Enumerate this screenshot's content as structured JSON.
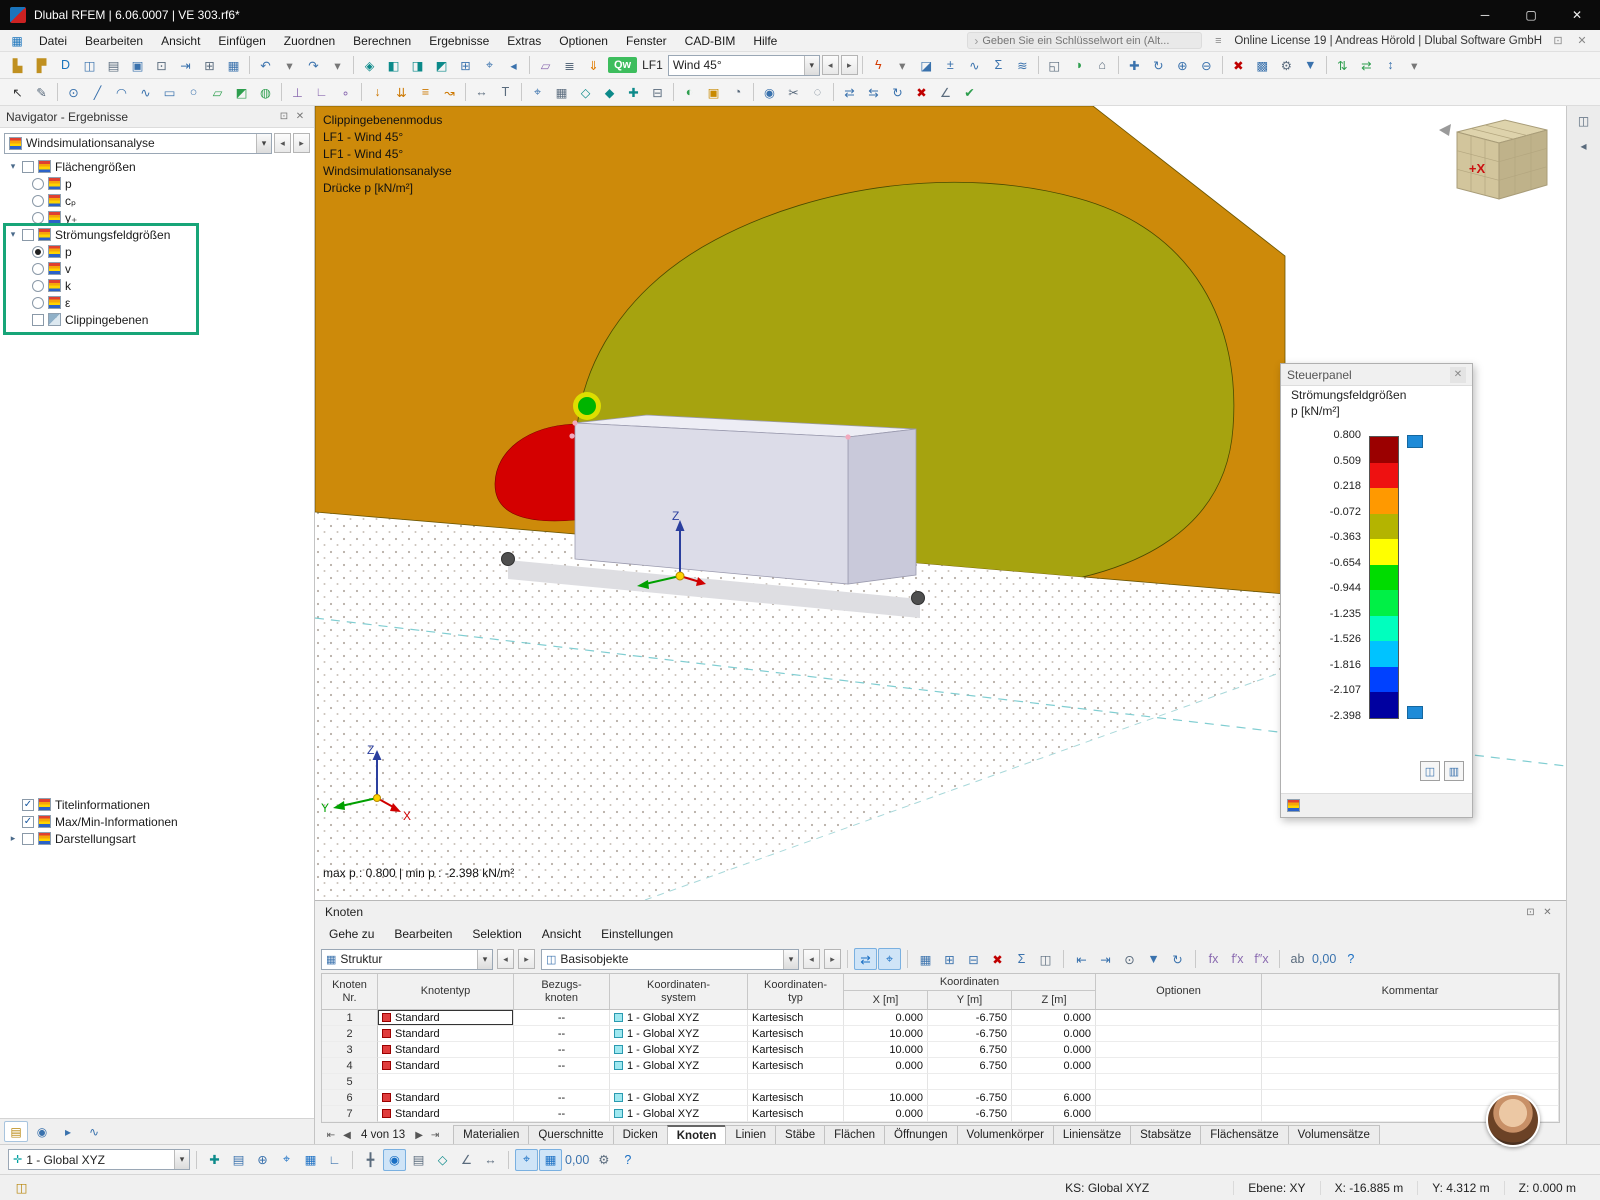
{
  "glyphs": {
    "close": "✕",
    "float": "⊡",
    "min": "─",
    "max": "▢",
    "combo": "▾",
    "back": "◂",
    "fwd": "▸",
    "first": "⇤",
    "prev": "◀",
    "next": "▶",
    "last": "⇥",
    "expander": "▾",
    "search_hint": "›"
  },
  "titlebar": {
    "title": "Dlubal RFEM | 6.06.0007 | VE 303.rf6*"
  },
  "menubar": {
    "app_icon": "▦",
    "items": [
      "Datei",
      "Bearbeiten",
      "Ansicht",
      "Einfügen",
      "Zuordnen",
      "Berechnen",
      "Ergebnisse",
      "Extras",
      "Optionen",
      "Fenster",
      "CAD-BIM",
      "Hilfe"
    ],
    "search_placeholder": "Geben Sie ein Schlüsselwort ein (Alt...",
    "shortcuts_icon": "≡",
    "license": "Online License 19 | Andreas Hörold | Dlubal Software GmbH"
  },
  "toolbars": {
    "r1a": [
      {
        "n": "new-model-icon",
        "g": "▙",
        "c": "#c09020"
      },
      {
        "n": "open-model-icon",
        "g": "▛",
        "c": "#c09020"
      },
      {
        "n": "dlubal-center-icon",
        "g": "D",
        "c": "#1a74bc"
      },
      {
        "n": "project-manager-icon",
        "g": "◫",
        "c": "#3a72ad"
      },
      {
        "n": "printout-report-icon",
        "g": "▤",
        "c": "#5a6b7d"
      },
      {
        "n": "save-icon",
        "g": "▣",
        "c": "#3a72ad"
      },
      {
        "n": "print-icon",
        "g": "⊡",
        "c": "#5a6b7d"
      },
      {
        "n": "export-icon",
        "g": "⇥",
        "c": "#3a72ad"
      },
      {
        "n": "copy-icon",
        "g": "⊞",
        "c": "#5a6b7d"
      },
      {
        "n": "tables-icon",
        "g": "▦",
        "c": "#3a72ad"
      }
    ],
    "r1b": [
      {
        "n": "undo-icon",
        "g": "↶",
        "c": "#3a72ad"
      },
      {
        "n": "undo-menu-icon",
        "g": "▾",
        "c": "#777777"
      },
      {
        "n": "redo-icon",
        "g": "↷",
        "c": "#3a72ad"
      },
      {
        "n": "redo-menu-icon",
        "g": "▾",
        "c": "#777777"
      }
    ],
    "r1c": [
      {
        "n": "isometric-view-icon",
        "g": "◈",
        "c": "#0c8a8a"
      },
      {
        "n": "view-in-x-icon",
        "g": "◧",
        "c": "#0c8a8a"
      },
      {
        "n": "view-in-y-icon",
        "g": "◨",
        "c": "#0c8a8a"
      },
      {
        "n": "view-in-z-icon",
        "g": "◩",
        "c": "#0c8a8a"
      },
      {
        "n": "zoom-window-icon",
        "g": "⊞",
        "c": "#3a72ad"
      },
      {
        "n": "zoom-all-icon",
        "g": "⌖",
        "c": "#3a72ad"
      },
      {
        "n": "previous-view-icon",
        "g": "◂",
        "c": "#3a72ad"
      }
    ],
    "r1d": [
      {
        "n": "work-plane-icon",
        "g": "▱",
        "c": "#8a6ab0"
      },
      {
        "n": "display-properties-icon",
        "g": "≣",
        "c": "#5a6b7d"
      },
      {
        "n": "show-loads-icon",
        "g": "⇓",
        "c": "#e07b00"
      }
    ],
    "loadcase": {
      "qw": "Qw",
      "label": "LF1",
      "value": "Wind 45°"
    },
    "r1e": [
      {
        "n": "show-results-icon",
        "g": "ϟ",
        "c": "#d43a00"
      },
      {
        "n": "results-menu-icon",
        "g": "▾",
        "c": "#777777"
      },
      {
        "n": "result-panel-icon",
        "g": "◪",
        "c": "#3a72ad"
      },
      {
        "n": "result-values-icon",
        "g": "±",
        "c": "#3a72ad"
      },
      {
        "n": "result-diagram-icon",
        "g": "∿",
        "c": "#3a72ad"
      },
      {
        "n": "max-min-values-icon",
        "g": "Σ",
        "c": "#3a72ad"
      },
      {
        "n": "smooth-results-icon",
        "g": "≋",
        "c": "#3a72ad"
      }
    ],
    "r1f": [
      {
        "n": "new-window-icon",
        "g": "◱",
        "c": "#5a6b7d"
      },
      {
        "n": "render-mode-icon",
        "g": "◑",
        "c": "#2e9e4e"
      },
      {
        "n": "full-screen-icon",
        "g": "⌂",
        "c": "#5a6b7d"
      }
    ],
    "r1g": [
      {
        "n": "pan-view-icon",
        "g": "✚",
        "c": "#3a72ad"
      },
      {
        "n": "rotate-view-icon",
        "g": "↻",
        "c": "#3a72ad"
      },
      {
        "n": "zoom-in-icon",
        "g": "⊕",
        "c": "#3a72ad"
      },
      {
        "n": "zoom-out-icon",
        "g": "⊖",
        "c": "#3a72ad"
      }
    ],
    "r1h": [
      {
        "n": "delete-results-icon",
        "g": "✖",
        "c": "#c00000"
      },
      {
        "n": "fe-mesh-icon",
        "g": "▩",
        "c": "#3a72ad"
      },
      {
        "n": "calculation-icon",
        "g": "⚙",
        "c": "#5a6b7d"
      },
      {
        "n": "filter-results-icon",
        "g": "▼",
        "c": "#3a72ad"
      }
    ],
    "r1i": [
      {
        "n": "sort-icon",
        "g": "⇅",
        "c": "#2e9e4e"
      },
      {
        "n": "arrange-windows-icon",
        "g": "⇄",
        "c": "#2e9e4e"
      },
      {
        "n": "numbering-icon",
        "g": "↕",
        "c": "#3a72ad"
      },
      {
        "n": "more-options-icon",
        "g": "▾",
        "c": "#777777"
      }
    ],
    "r2a": [
      {
        "n": "select-pointer-icon",
        "g": "↖",
        "c": "#333333"
      },
      {
        "n": "edit-objects-icon",
        "g": "✎",
        "c": "#5a6b7d"
      }
    ],
    "r2b": [
      {
        "n": "new-node-icon",
        "g": "⊙",
        "c": "#3a72ad"
      },
      {
        "n": "new-line-icon",
        "g": "╱",
        "c": "#3a72ad"
      },
      {
        "n": "new-arc-icon",
        "g": "◠",
        "c": "#3a72ad"
      },
      {
        "n": "new-polyline-icon",
        "g": "∿",
        "c": "#3a72ad"
      },
      {
        "n": "new-rectangle-icon",
        "g": "▭",
        "c": "#3a72ad"
      },
      {
        "n": "new-circle-icon",
        "g": "○",
        "c": "#3a72ad"
      },
      {
        "n": "new-surface-icon",
        "g": "▱",
        "c": "#2e9e4e"
      },
      {
        "n": "new-solid-icon",
        "g": "◩",
        "c": "#2e9e4e"
      },
      {
        "n": "new-opening-icon",
        "g": "◍",
        "c": "#2e9e4e"
      }
    ],
    "r2c": [
      {
        "n": "nodal-support-icon",
        "g": "⊥",
        "c": "#8a6ab0"
      },
      {
        "n": "line-support-icon",
        "g": "∟",
        "c": "#8a6ab0"
      },
      {
        "n": "member-hinge-icon",
        "g": "∘",
        "c": "#8a6ab0"
      }
    ],
    "r2d": [
      {
        "n": "nodal-load-icon",
        "g": "↓",
        "c": "#cc7700"
      },
      {
        "n": "line-load-icon",
        "g": "⇊",
        "c": "#cc7700"
      },
      {
        "n": "surface-load-icon",
        "g": "≡",
        "c": "#cc7700"
      },
      {
        "n": "free-load-icon",
        "g": "↝",
        "c": "#cc7700"
      }
    ],
    "r2e": [
      {
        "n": "dimension-icon",
        "g": "↔",
        "c": "#5a6b7d"
      },
      {
        "n": "annotation-icon",
        "g": "T",
        "c": "#5a6b7d"
      }
    ],
    "r2f": [
      {
        "n": "snap-settings-icon",
        "g": "⌖",
        "c": "#3a72ad"
      },
      {
        "n": "grid-settings-icon",
        "g": "▦",
        "c": "#5a6b7d"
      },
      {
        "n": "work-plane-xy-icon",
        "g": "◇",
        "c": "#0c8a8a"
      },
      {
        "n": "work-plane-xz-icon",
        "g": "◆",
        "c": "#0c8a8a"
      },
      {
        "n": "user-coordinate-system-icon",
        "g": "✚",
        "c": "#0c8a8a"
      },
      {
        "n": "plane-offset-icon",
        "g": "⊟",
        "c": "#5a6b7d"
      }
    ],
    "r2g": [
      {
        "n": "display-mode-icon",
        "g": "◐",
        "c": "#2e9e4e"
      },
      {
        "n": "rendered-model-icon",
        "g": "▣",
        "c": "#c98a00"
      },
      {
        "n": "section-view-icon",
        "g": "◔",
        "c": "#5a6b7d"
      }
    ],
    "r2h": [
      {
        "n": "visibility-icon",
        "g": "◉",
        "c": "#3a72ad"
      },
      {
        "n": "clipping-plane-icon",
        "g": "✂",
        "c": "#5a6b7d"
      },
      {
        "n": "isolate-objects-icon",
        "g": "◌",
        "c": "#5a6b7d"
      }
    ],
    "r2i": [
      {
        "n": "mirror-objects-icon",
        "g": "⇄",
        "c": "#3a72ad"
      },
      {
        "n": "move-objects-icon",
        "g": "⇆",
        "c": "#3a72ad"
      },
      {
        "n": "rotate-objects-icon",
        "g": "↻",
        "c": "#3a72ad"
      },
      {
        "n": "delete-objects-icon",
        "g": "✖",
        "c": "#c00000"
      },
      {
        "n": "measure-icon",
        "g": "∠",
        "c": "#5a6b7d"
      },
      {
        "n": "model-check-icon",
        "g": "✔",
        "c": "#2e9e4e"
      }
    ]
  },
  "navigator": {
    "title": "Navigator - Ergebnisse",
    "dropdown": "Windsimulationsanalyse",
    "tree": {
      "group1": {
        "label": "Flächengrößen",
        "items": [
          {
            "label": "p"
          },
          {
            "label": "cₚ"
          },
          {
            "label": "y₊"
          }
        ]
      },
      "group2": {
        "label": "Strömungsfeldgrößen",
        "items": [
          {
            "label": "p",
            "selected": true
          },
          {
            "label": "v"
          },
          {
            "label": "k"
          },
          {
            "label": "ε"
          }
        ],
        "clipping": "Clippingebenen"
      }
    },
    "lower": [
      {
        "label": "Titelinformationen",
        "check": "✓"
      },
      {
        "label": "Max/Min-Informationen",
        "check": "✓"
      },
      {
        "label": "Darstellungsart",
        "expand": "▸"
      }
    ],
    "tabs": [
      {
        "n": "data-panel-tab",
        "g": "▤",
        "c": "#b8860b",
        "on": true
      },
      {
        "n": "display-panel-tab",
        "g": "◉",
        "c": "#3a72ad"
      },
      {
        "n": "views-panel-tab",
        "g": "▸",
        "c": "#3a72ad"
      },
      {
        "n": "charts-panel-tab",
        "g": "∿",
        "c": "#3a72ad"
      }
    ]
  },
  "viewport": {
    "overlay": [
      "Clippingebenenmodus",
      "LF1 - Wind 45°",
      "LF1 - Wind 45°",
      "Windsimulationsanalyse",
      "Drücke p [kN/m²]"
    ],
    "minmax": "max p : 0.800 | min p : -2.398 kN/m²",
    "cube_label": "+X",
    "axes": {
      "x": "X",
      "y": "Y",
      "z": "Z"
    }
  },
  "scene": {
    "field_orange": "#cd8a0a",
    "field_olive": "#a6a30f",
    "field_red": "#d40000",
    "field_green": "#00b400",
    "field_yellow": "#dede00",
    "building_front": "#dcdce8",
    "building_top": "#ededf5",
    "building_side": "#c9c9da"
  },
  "legend": {
    "title": "Steuerpanel",
    "subtitle1": "Strömungsfeldgrößen",
    "subtitle2": "p [kN/m²]",
    "values": [
      "0.800",
      "0.509",
      "0.218",
      "-0.072",
      "-0.363",
      "-0.654",
      "-0.944",
      "-1.235",
      "-1.526",
      "-1.816",
      "-2.107",
      "-2.398"
    ],
    "colors": [
      "#9b0000",
      "#ee1111",
      "#ff9900",
      "#b4b400",
      "#ffff00",
      "#00dc00",
      "#00f046",
      "#00ffbe",
      "#00c3ff",
      "#0041ff",
      "#0000a0"
    ],
    "btn1": "◫",
    "btn2": "▥"
  },
  "table": {
    "title": "Knoten",
    "menu": [
      "Gehe zu",
      "Bearbeiten",
      "Selektion",
      "Ansicht",
      "Einstellungen"
    ],
    "combo1_icon": "▦",
    "combo1": "Struktur",
    "combo2_icon": "◫",
    "combo2": "Basisobjekte",
    "ta": [
      {
        "n": "sync-selection-icon",
        "g": "⇄",
        "c": "#1a6fc4",
        "on": true
      },
      {
        "n": "jump-to-object-icon",
        "g": "⌖",
        "c": "#1a6fc4",
        "on": true
      }
    ],
    "tb": [
      {
        "n": "table-settings-icon",
        "g": "▦",
        "c": "#3a72ad"
      },
      {
        "n": "insert-row-icon",
        "g": "⊞",
        "c": "#3a72ad"
      },
      {
        "n": "delete-row-icon",
        "g": "⊟",
        "c": "#3a72ad"
      },
      {
        "n": "clear-table-icon",
        "g": "✖",
        "c": "#c00000"
      },
      {
        "n": "sum-icon",
        "g": "Σ",
        "c": "#3a72ad"
      },
      {
        "n": "table-views-icon",
        "g": "◫",
        "c": "#5a6b7d"
      }
    ],
    "tc": [
      {
        "n": "import-table-icon",
        "g": "⇤",
        "c": "#3a72ad"
      },
      {
        "n": "export-table-icon",
        "g": "⇥",
        "c": "#3a72ad"
      },
      {
        "n": "find-icon",
        "g": "⊙",
        "c": "#5a6b7d"
      },
      {
        "n": "filter-rows-icon",
        "g": "▼",
        "c": "#3a72ad"
      },
      {
        "n": "refresh-table-icon",
        "g": "↻",
        "c": "#3a72ad"
      }
    ],
    "td": [
      {
        "n": "function-fx-icon",
        "g": "fx",
        "c": "#8a6ab0"
      },
      {
        "n": "function-derivative-icon",
        "g": "f′x",
        "c": "#8a6ab0"
      },
      {
        "n": "function-second-derivative-icon",
        "g": "f″x",
        "c": "#8a6ab0"
      }
    ],
    "te": [
      {
        "n": "spell-check-icon",
        "g": "ab",
        "c": "#5a6b7d"
      },
      {
        "n": "decimal-places-icon",
        "g": "0,00",
        "c": "#3a72ad"
      },
      {
        "n": "table-help-icon",
        "g": "?",
        "c": "#1a6fc4"
      }
    ],
    "columns": {
      "nr1": "Knoten",
      "nr2": "Nr.",
      "typ": "Knotentyp",
      "bezug1": "Bezugs-",
      "bezug2": "knoten",
      "ksys1": "Koordinaten-",
      "ksys2": "system",
      "ktyp1": "Koordinaten-",
      "ktyp2": "typ",
      "coords": "Koordinaten",
      "x": "X [m]",
      "y": "Y [m]",
      "z": "Z [m]",
      "optionen": "Optionen",
      "kommentar": "Kommentar"
    },
    "rows": [
      {
        "nr": "1",
        "typ": "Standard",
        "bezug": "--",
        "ksys": "1 - Global XYZ",
        "ktyp": "Kartesisch",
        "x": "0.000",
        "y": "-6.750",
        "z": "0.000"
      },
      {
        "nr": "2",
        "typ": "Standard",
        "bezug": "--",
        "ksys": "1 - Global XYZ",
        "ktyp": "Kartesisch",
        "x": "10.000",
        "y": "-6.750",
        "z": "0.000"
      },
      {
        "nr": "3",
        "typ": "Standard",
        "bezug": "--",
        "ksys": "1 - Global XYZ",
        "ktyp": "Kartesisch",
        "x": "10.000",
        "y": "6.750",
        "z": "0.000"
      },
      {
        "nr": "4",
        "typ": "Standard",
        "bezug": "--",
        "ksys": "1 - Global XYZ",
        "ktyp": "Kartesisch",
        "x": "0.000",
        "y": "6.750",
        "z": "0.000"
      },
      {
        "nr": "5"
      },
      {
        "nr": "6",
        "typ": "Standard",
        "bezug": "--",
        "ksys": "1 - Global XYZ",
        "ktyp": "Kartesisch",
        "x": "10.000",
        "y": "-6.750",
        "z": "6.000"
      },
      {
        "nr": "7",
        "typ": "Standard",
        "bezug": "--",
        "ksys": "1 - Global XYZ",
        "ktyp": "Kartesisch",
        "x": "0.000",
        "y": "-6.750",
        "z": "6.000"
      }
    ],
    "pager": "4 von 13",
    "tabs": [
      {
        "label": "Materialien"
      },
      {
        "label": "Querschnitte"
      },
      {
        "label": "Dicken"
      },
      {
        "label": "Knoten",
        "active": true
      },
      {
        "label": "Linien"
      },
      {
        "label": "Stäbe"
      },
      {
        "label": "Flächen"
      },
      {
        "label": "Öffnungen"
      },
      {
        "label": "Volumenkörper"
      },
      {
        "label": "Liniensätze"
      },
      {
        "label": "Stabsätze"
      },
      {
        "label": "Flächensätze"
      },
      {
        "label": "Volumensätze"
      }
    ]
  },
  "bottombar": {
    "cs_icon": "✛",
    "cs_value": "1 - Global XYZ",
    "bb2": [
      {
        "n": "new-ucs-icon",
        "g": "✚",
        "c": "#0c8a8a"
      },
      {
        "n": "ucs-manager-icon",
        "g": "▤",
        "c": "#3a72ad"
      },
      {
        "n": "origin-icon",
        "g": "⊕",
        "c": "#3a72ad"
      },
      {
        "n": "snap-icon",
        "g": "⌖",
        "c": "#1a6fc4"
      },
      {
        "n": "grid-icon",
        "g": "▦",
        "c": "#1a6fc4"
      },
      {
        "n": "ortho-icon",
        "g": "∟",
        "c": "#3a72ad"
      }
    ],
    "bb3": [
      {
        "n": "guidelines-icon",
        "g": "╋",
        "c": "#5a6b7d"
      },
      {
        "n": "object-snap-icon",
        "g": "◉",
        "c": "#1a6fc4",
        "on": true
      },
      {
        "n": "line-grid-icon",
        "g": "▤",
        "c": "#5a6b7d"
      },
      {
        "n": "plane-snap-icon",
        "g": "◇",
        "c": "#0c8a8a"
      },
      {
        "n": "angle-snap-icon",
        "g": "∠",
        "c": "#5a6b7d"
      },
      {
        "n": "dimension-input-icon",
        "g": "↔",
        "c": "#5a6b7d"
      }
    ],
    "bb4": [
      {
        "n": "snap-toggle-icon",
        "g": "⌖",
        "c": "#1a6fc4",
        "on": true
      },
      {
        "n": "grid-toggle-icon",
        "g": "▦",
        "c": "#1a6fc4",
        "on": true
      },
      {
        "n": "decimal-places-icon",
        "g": "0,00",
        "c": "#3a72ad"
      },
      {
        "n": "settings-icon",
        "g": "⚙",
        "c": "#5a6b7d"
      },
      {
        "n": "help-icon",
        "g": "?",
        "c": "#1a6fc4"
      }
    ],
    "strip": [
      {
        "n": "panel-pin-icon",
        "g": "◫",
        "c": "#5a6b7d"
      },
      {
        "n": "panel-expand-icon",
        "g": "◂",
        "c": "#5a6b7d"
      }
    ],
    "status_icon": {
      "n": "status-panel-icon",
      "g": "◫",
      "c": "#b8860b"
    }
  },
  "statusbar": {
    "ks": "KS: Global XYZ",
    "plane": "Ebene: XY",
    "x": "X: -16.885 m",
    "y": "Y: 4.312 m",
    "z": "Z: 0.000 m"
  }
}
